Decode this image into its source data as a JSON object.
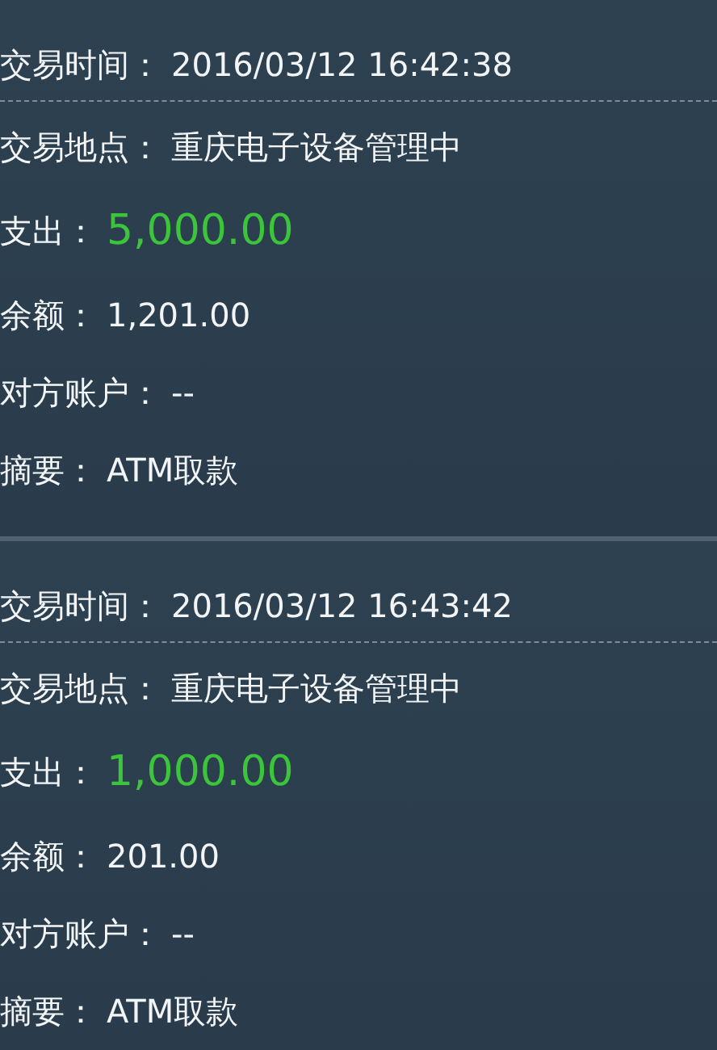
{
  "transactions": [
    {
      "rows": [
        {
          "kind": "time",
          "label": "交易时间：",
          "value": "2016/03/12 16:42:38"
        },
        {
          "kind": "location",
          "label": "交易地点：",
          "value": "重庆电子设备管理中"
        },
        {
          "kind": "amount",
          "label": "支出：",
          "value": "5,000.00"
        },
        {
          "kind": "balance",
          "label": "余额：",
          "value": "1,201.00"
        },
        {
          "kind": "counterparty",
          "label": "对方账户：",
          "value": "--"
        },
        {
          "kind": "memo",
          "label": "摘要：",
          "value": "ATM取款"
        }
      ]
    },
    {
      "rows": [
        {
          "kind": "time",
          "label": "交易时间：",
          "value": "2016/03/12 16:43:42"
        },
        {
          "kind": "location",
          "label": "交易地点：",
          "value": "重庆电子设备管理中"
        },
        {
          "kind": "amount",
          "label": "支出：",
          "value": "1,000.00"
        },
        {
          "kind": "balance",
          "label": "余额：",
          "value": "201.00"
        },
        {
          "kind": "counterparty",
          "label": "对方账户：",
          "value": "--"
        },
        {
          "kind": "memo",
          "label": "摘要：",
          "value": "ATM取款"
        }
      ]
    }
  ]
}
